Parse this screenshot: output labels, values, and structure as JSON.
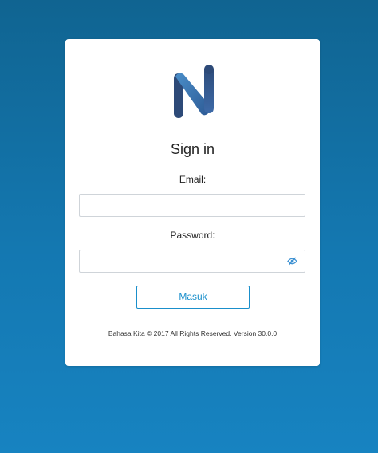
{
  "login": {
    "title": "Sign in",
    "email_label": "Email:",
    "email_value": "",
    "password_label": "Password:",
    "password_value": "",
    "submit_label": "Masuk",
    "footer": "Bahasa Kita © 2017 All Rights Reserved. Version 30.0.0"
  },
  "icons": {
    "logo": "bahasa-kita-logo",
    "password_toggle": "eye-slash-icon"
  },
  "colors": {
    "background_top": "#106491",
    "background_bottom": "#1783c1",
    "logo_dark": "#2d4a78",
    "logo_light": "#4a8ec9",
    "button_accent": "#1a8fcb",
    "eye_icon": "#3a8fd1"
  }
}
